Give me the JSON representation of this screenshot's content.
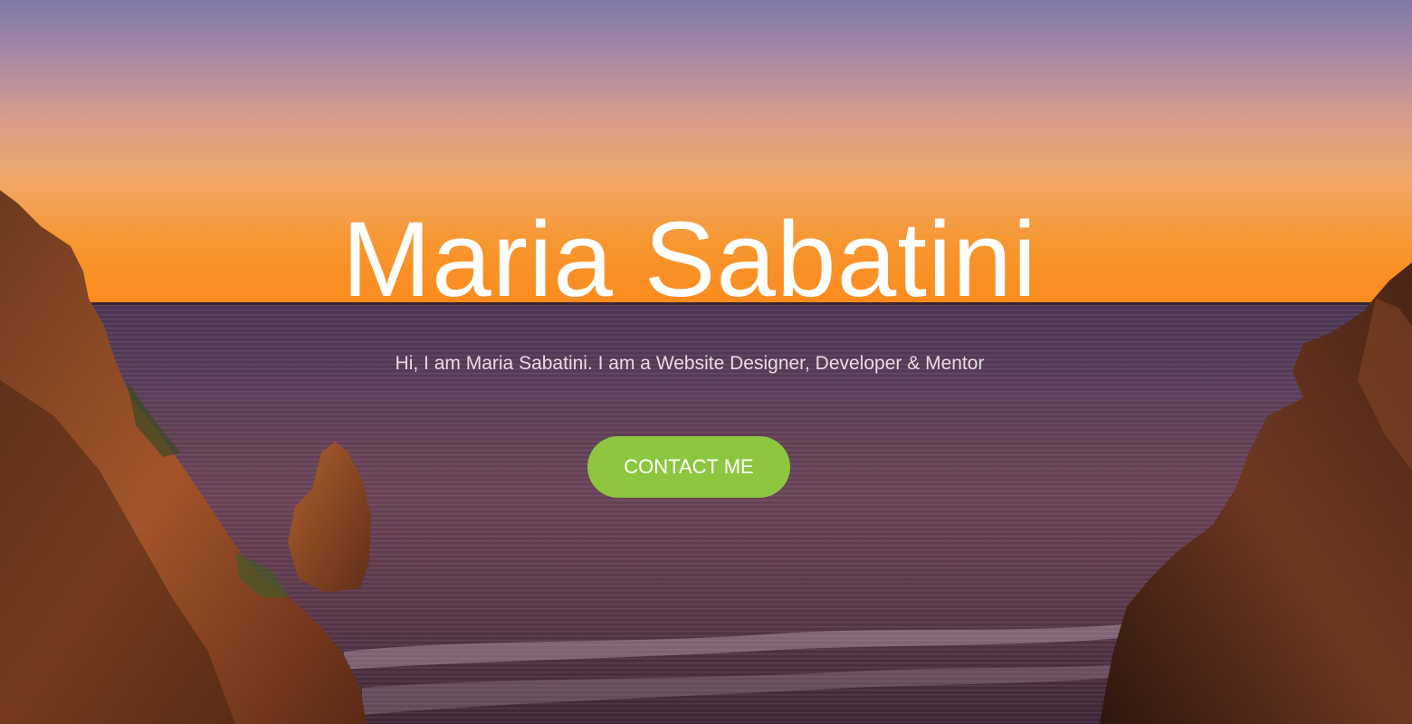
{
  "hero": {
    "title": "Maria Sabatini",
    "subtitle": "Hi, I am Maria Sabatini. I am a Website Designer, Developer & Mentor",
    "cta_label": "CONTACT ME",
    "background": "sunset-over-sea-cliffs-image"
  },
  "colors": {
    "cta_background": "#8dc63f",
    "title_text": "#ffffff",
    "subtitle_text": "#e6dde3"
  }
}
